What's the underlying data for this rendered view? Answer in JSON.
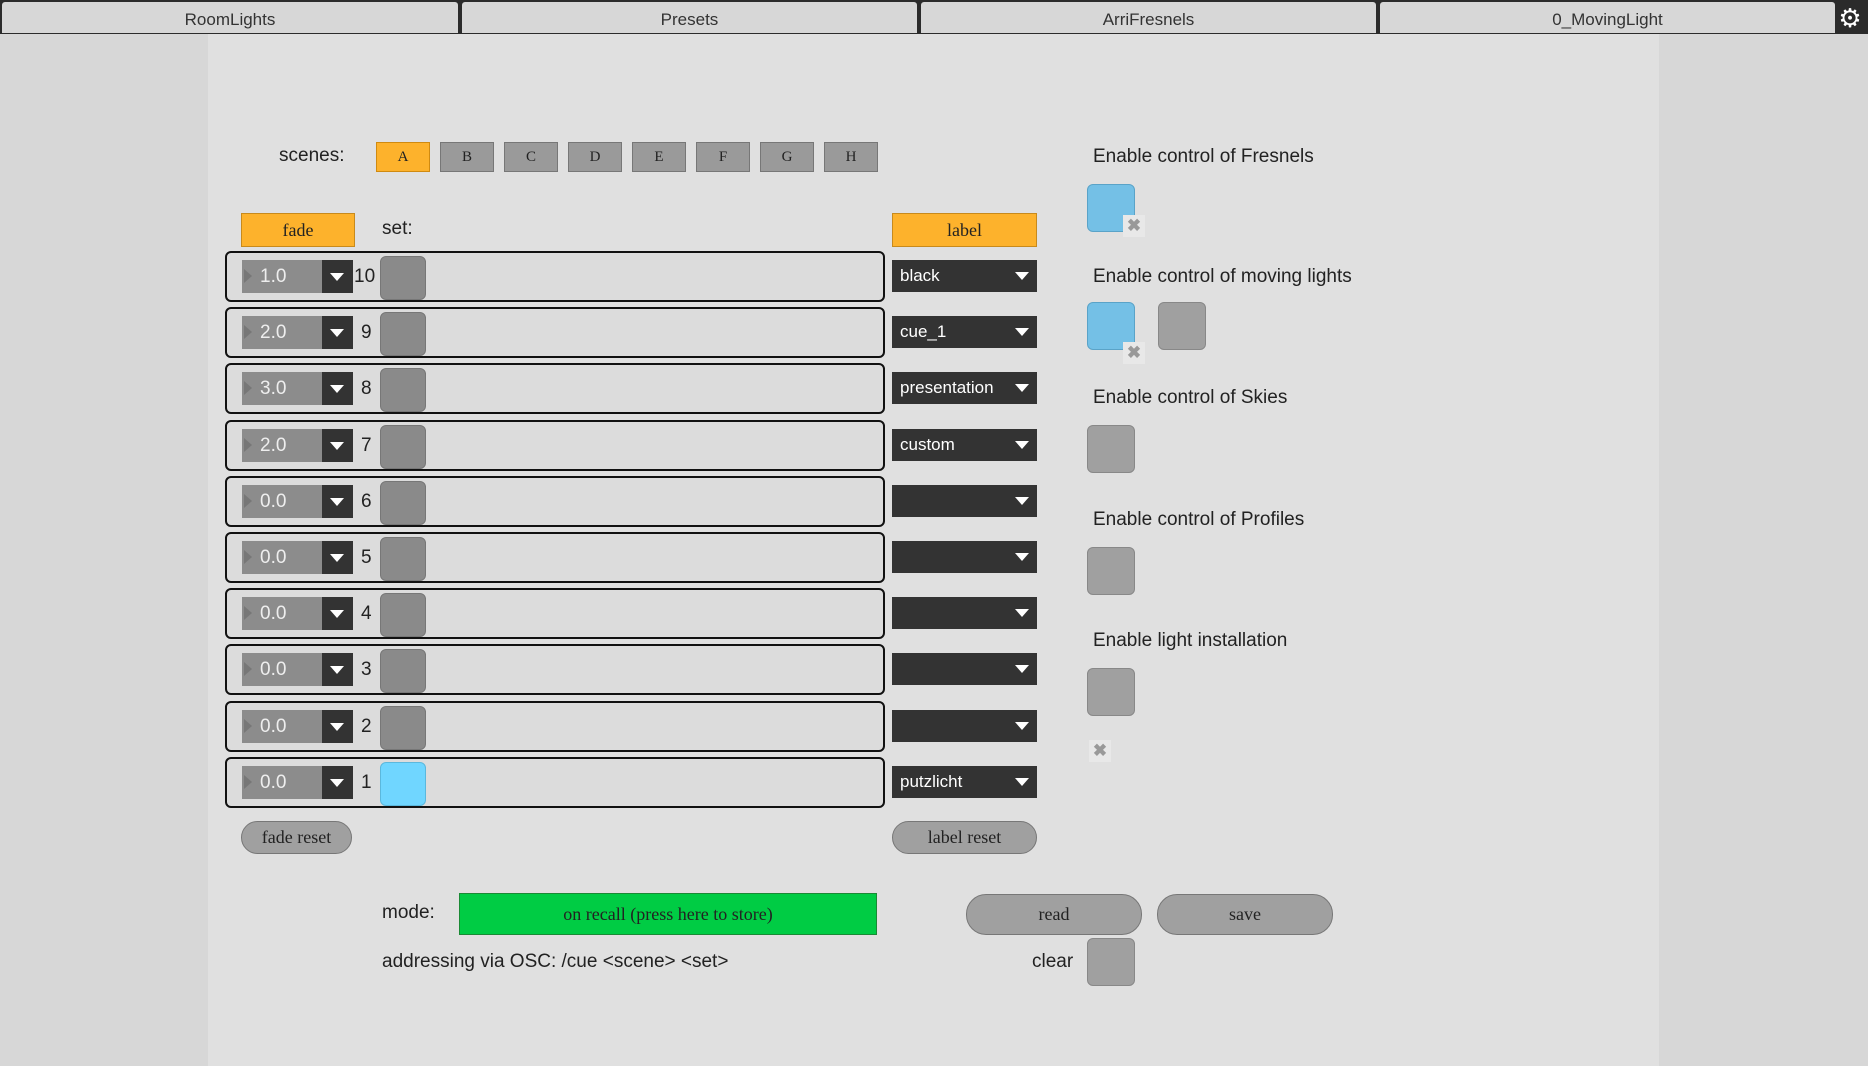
{
  "tabs": [
    {
      "label": "RoomLights"
    },
    {
      "label": "Presets"
    },
    {
      "label": "ArriFresnels"
    },
    {
      "label": "0_MovingLight"
    }
  ],
  "settings_icon": "gear-icon",
  "scenes": {
    "label": "scenes:",
    "buttons": [
      "A",
      "B",
      "C",
      "D",
      "E",
      "F",
      "G",
      "H"
    ],
    "active": "A"
  },
  "fade_header": "fade",
  "set_header": "set:",
  "label_header": "label",
  "rows": [
    {
      "fade": "1.0",
      "num": "10",
      "label": "black",
      "set_on": false
    },
    {
      "fade": "2.0",
      "num": "9",
      "label": "cue_1",
      "set_on": false
    },
    {
      "fade": "3.0",
      "num": "8",
      "label": "presentation",
      "set_on": false
    },
    {
      "fade": "2.0",
      "num": "7",
      "label": "custom",
      "set_on": false
    },
    {
      "fade": "0.0",
      "num": "6",
      "label": "",
      "set_on": false
    },
    {
      "fade": "0.0",
      "num": "5",
      "label": "",
      "set_on": false
    },
    {
      "fade": "0.0",
      "num": "4",
      "label": "",
      "set_on": false
    },
    {
      "fade": "0.0",
      "num": "3",
      "label": "",
      "set_on": false
    },
    {
      "fade": "0.0",
      "num": "2",
      "label": "",
      "set_on": false
    },
    {
      "fade": "0.0",
      "num": "1",
      "label": "putzlicht",
      "set_on": true
    }
  ],
  "fade_reset": "fade reset",
  "label_reset": "label reset",
  "controls": {
    "fresnels": "Enable control of Fresnels",
    "moving": "Enable control of moving lights",
    "skies": "Enable control of Skies",
    "profiles": "Enable control of Profiles",
    "installation": "Enable light installation"
  },
  "mode_label": "mode:",
  "mode_value": "on recall (press here to store)",
  "osc_note": "addressing via OSC: /cue <scene> <set>",
  "read_label": "read",
  "save_label": "save",
  "clear_label": "clear",
  "x_glyph": "✖",
  "colors": {
    "accent": "#fdb22c",
    "toggle_on": "#74c0e6",
    "set_on": "#70d6ff",
    "mode": "#00cc44"
  }
}
